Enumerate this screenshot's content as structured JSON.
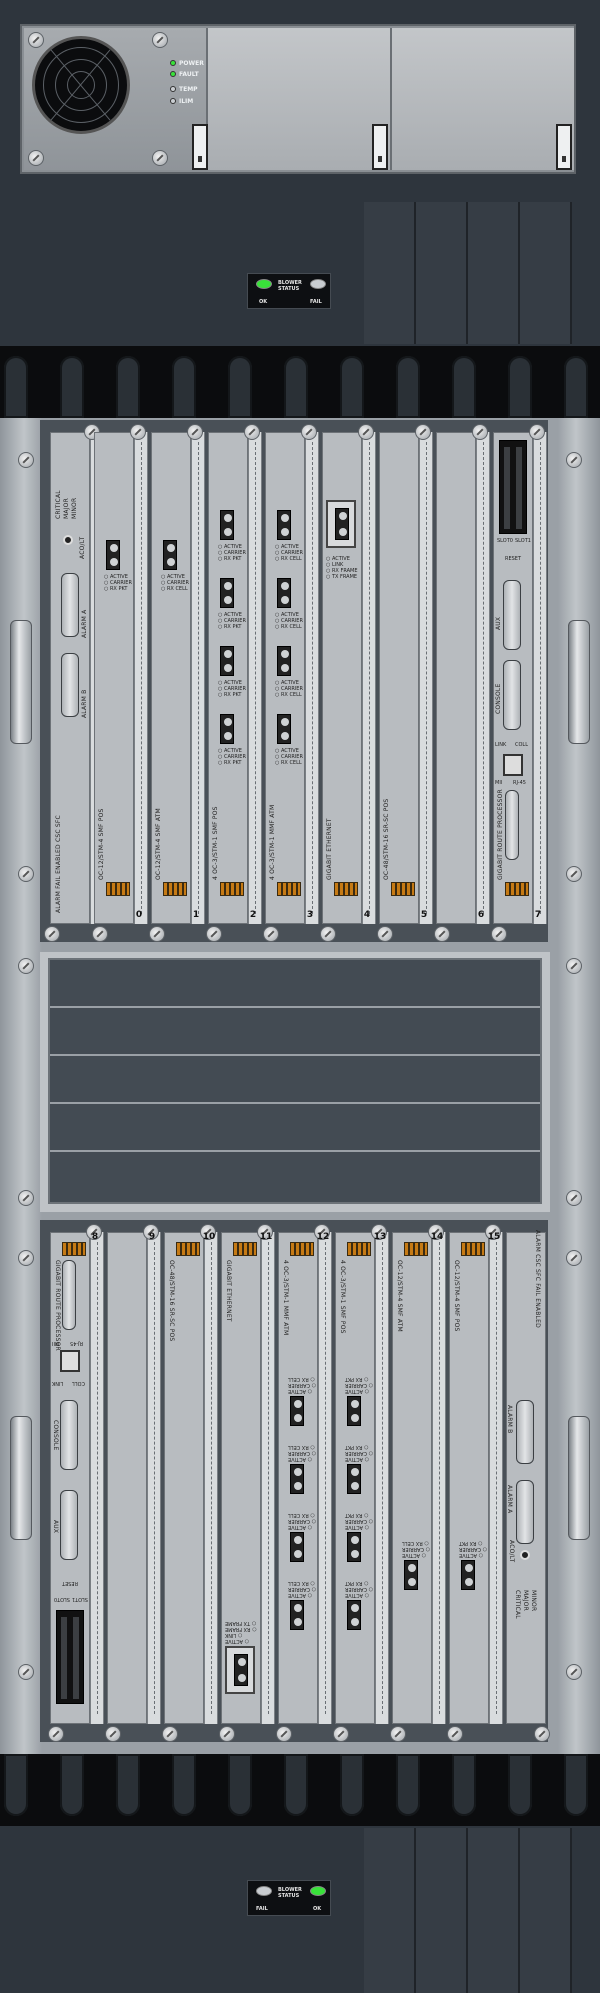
{
  "colors": {
    "led_green": "#39e23a",
    "led_off": "#c9cdd1",
    "led_amber": "#c67a14"
  },
  "power_supply": {
    "indicators": [
      {
        "label": "POWER",
        "state": "on"
      },
      {
        "label": "FAULT",
        "state": "on"
      },
      {
        "label": "TEMP",
        "state": "off"
      },
      {
        "label": "ILIM",
        "state": "off"
      }
    ]
  },
  "blower_top": {
    "title": "BLOWER",
    "subtitle": "STATUS",
    "ok": "OK",
    "fail": "FAIL"
  },
  "blower_bottom": {
    "title": "BLOWER",
    "subtitle": "STATUS",
    "ok": "OK",
    "fail": "FAIL"
  },
  "upper_slots": [
    {
      "num": "0",
      "label": "OC-12/STM-4 SMF POS"
    },
    {
      "num": "1",
      "label": "OC-12/STM-4 SMF ATM"
    },
    {
      "num": "2",
      "label": "4 OC-3/STM-1 SMF POS"
    },
    {
      "num": "3",
      "label": "4 OC-3/STM-1 MMF ATM"
    },
    {
      "num": "4",
      "label": "GIGABIT ETHERNET"
    },
    {
      "num": "5",
      "label": "OC-48/STM-16 SR-SC POS"
    },
    {
      "num": "6",
      "label": ""
    },
    {
      "num": "7",
      "label": "GIGABIT ROUTE PROCESSOR"
    }
  ],
  "lower_slots": [
    {
      "num": "8",
      "label": "GIGABIT ROUTE PROCESSOR"
    },
    {
      "num": "9",
      "label": ""
    },
    {
      "num": "10",
      "label": "OC-48/STM-16 SR-SC POS"
    },
    {
      "num": "11",
      "label": "GIGABIT ETHERNET"
    },
    {
      "num": "12",
      "label": "4 OC-3/STM-1 MMF ATM"
    },
    {
      "num": "13",
      "label": "4 OC-3/STM-1 SMF POS"
    },
    {
      "num": "14",
      "label": "OC-12/STM-4 SMF ATM"
    },
    {
      "num": "15",
      "label": "OC-12/STM-4 SMF POS"
    }
  ],
  "csc": {
    "title": "CSC SFC",
    "enabled": "ENABLED",
    "fail": "FAIL",
    "alarm": "ALARM",
    "alarm_a": "ALARM A",
    "alarm_b": "ALARM B",
    "critical": "CRITICAL",
    "major": "MAJOR",
    "minor": "MINOR",
    "acoct": "ACO/LT"
  },
  "port_led_labels": {
    "pos": [
      "ACTIVE",
      "CARRIER",
      "RX PKT"
    ],
    "atm": [
      "ACTIVE",
      "CARRIER",
      "RX CELL"
    ],
    "ge": [
      "ACTIVE",
      "LINK",
      "RX FRAME",
      "TX FRAME"
    ]
  },
  "grp": {
    "slot0": "SLOT0",
    "slot1": "SLOT1",
    "reset": "RESET",
    "aux": "AUX",
    "console": "CONSOLE",
    "link": "LINK",
    "coll": "COLL",
    "mii": "MII",
    "rj45": "RJ-45"
  }
}
